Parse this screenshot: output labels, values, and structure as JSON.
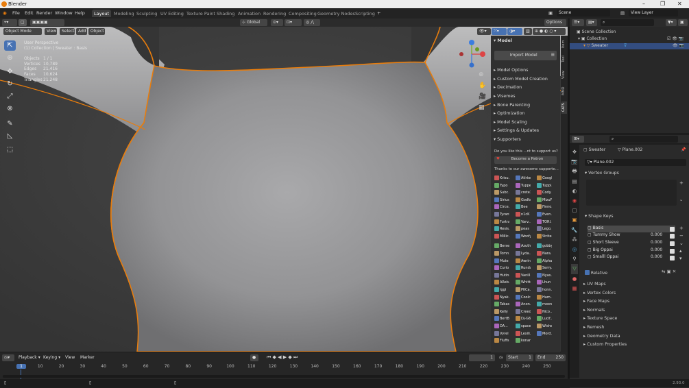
{
  "window": {
    "title": "Blender"
  },
  "menu": [
    "File",
    "Edit",
    "Render",
    "Window",
    "Help"
  ],
  "workspaces": [
    "Layout",
    "Modeling",
    "Sculpting",
    "UV Editing",
    "Texture Paint",
    "Shading",
    "Animation",
    "Rendering",
    "Compositing",
    "Geometry Nodes",
    "Scripting"
  ],
  "scene": {
    "name": "Scene",
    "view_layer": "View Layer"
  },
  "viewport_header": {
    "mode": "Object Mode",
    "menus": [
      "View",
      "Select",
      "Add",
      "Object"
    ],
    "transform": "Global",
    "options": "Options"
  },
  "overlay": {
    "perspective": "User Perspective",
    "collection": "(1) Collection | Sweater : Basis"
  },
  "stats": [
    {
      "label": "Objects",
      "value": "1 / 1"
    },
    {
      "label": "Vertices",
      "value": "10,789"
    },
    {
      "label": "Edges",
      "value": "21,416"
    },
    {
      "label": "Faces",
      "value": "10,624"
    },
    {
      "label": "Triangles",
      "value": "21,248"
    }
  ],
  "npanel": {
    "model_header": "Model",
    "import_button": "Import Model",
    "sections": [
      "Model Options",
      "Custom Model Creation",
      "Decimation",
      "Visemes",
      "Bone Parenting",
      "Optimization",
      "Model Scaling",
      "Settings & Updates",
      "Supporters"
    ],
    "support_text": "Do you like this ...nt to support us?",
    "patron_button": "Become a Patron",
    "thanks_text": "Thanks to our awesome supporte...",
    "tabs": [
      "Item",
      "Tool",
      "View",
      "MMD",
      "CATS"
    ]
  },
  "supporters": [
    "Krisu...",
    "Atirion",
    "Google",
    "Typo",
    "Tupper",
    "Tuppi...",
    "Subc...",
    "crete1",
    "Cody...",
    "Sirius...",
    "Godfat",
    "MizuF...",
    "Circe...",
    "Bee",
    "Finno...",
    "Tyrant",
    "n1cK",
    "Even...",
    "Furtrap",
    "Varv...",
    "TORI...",
    "Resis...",
    "peas",
    "Lego...",
    "Millic...",
    "Woofy",
    "Strite",
    "Berse...",
    "Azuth",
    "gobby",
    "Tomn...",
    "Lyda...",
    "Nara...",
    "Mute",
    "Awrini",
    "Alpha...",
    "Curio",
    "Runda",
    "Serry...",
    "Huting",
    "Vanill...",
    "Nyas...",
    "AReb...",
    "Whittz",
    "Lhun",
    "Iggi",
    "PKCa...",
    "honn...",
    "Nyak...",
    "Coolc...",
    "Ham...",
    "Tabas...",
    "Anon...",
    "moon...",
    "Kelly",
    "Creed...",
    "Nico...",
    "BertB...",
    "Dj-G6...",
    "Lucif...",
    "DA...",
    "space...",
    "Wishes",
    "Vyrel",
    "Lexili...",
    "Mord...",
    "Fluffs...",
    "konan"
  ],
  "outliner": {
    "root": "Scene Collection",
    "collection": "Collection",
    "object": "Sweater"
  },
  "properties": {
    "object": "Sweater",
    "mesh": "Plane.002",
    "mesh_field": "Plane.002",
    "vertex_groups": "Vertex Groups",
    "shape_keys_header": "Shape Keys",
    "shape_keys": [
      {
        "name": "Basis",
        "value": ""
      },
      {
        "name": "Tummy Show",
        "value": "0.000"
      },
      {
        "name": "Short Sleeve",
        "value": "0.000"
      },
      {
        "name": "Big Oppai",
        "value": "0.000"
      },
      {
        "name": "Smalll Oppai",
        "value": "0.000"
      }
    ],
    "relative": "Relative",
    "panels": [
      "UV Maps",
      "Vertex Colors",
      "Face Maps",
      "Normals",
      "Texture Space",
      "Remesh",
      "Geometry Data",
      "Custom Properties"
    ]
  },
  "timeline": {
    "menus": [
      "Playback",
      "Keying",
      "View",
      "Marker"
    ],
    "current_frame": "1",
    "start_label": "Start",
    "start": "1",
    "end_label": "End",
    "end": "250",
    "ticks": [
      "1",
      "10",
      "20",
      "30",
      "40",
      "50",
      "60",
      "70",
      "80",
      "90",
      "100",
      "110",
      "120",
      "130",
      "140",
      "150",
      "160",
      "170",
      "180",
      "190",
      "200",
      "210",
      "220",
      "230",
      "240",
      "250"
    ]
  },
  "status": {
    "version": "2.93.0"
  },
  "colors": {
    "accent": "#4772b3",
    "selection": "#e87d0d",
    "active_row": "#334d80"
  }
}
